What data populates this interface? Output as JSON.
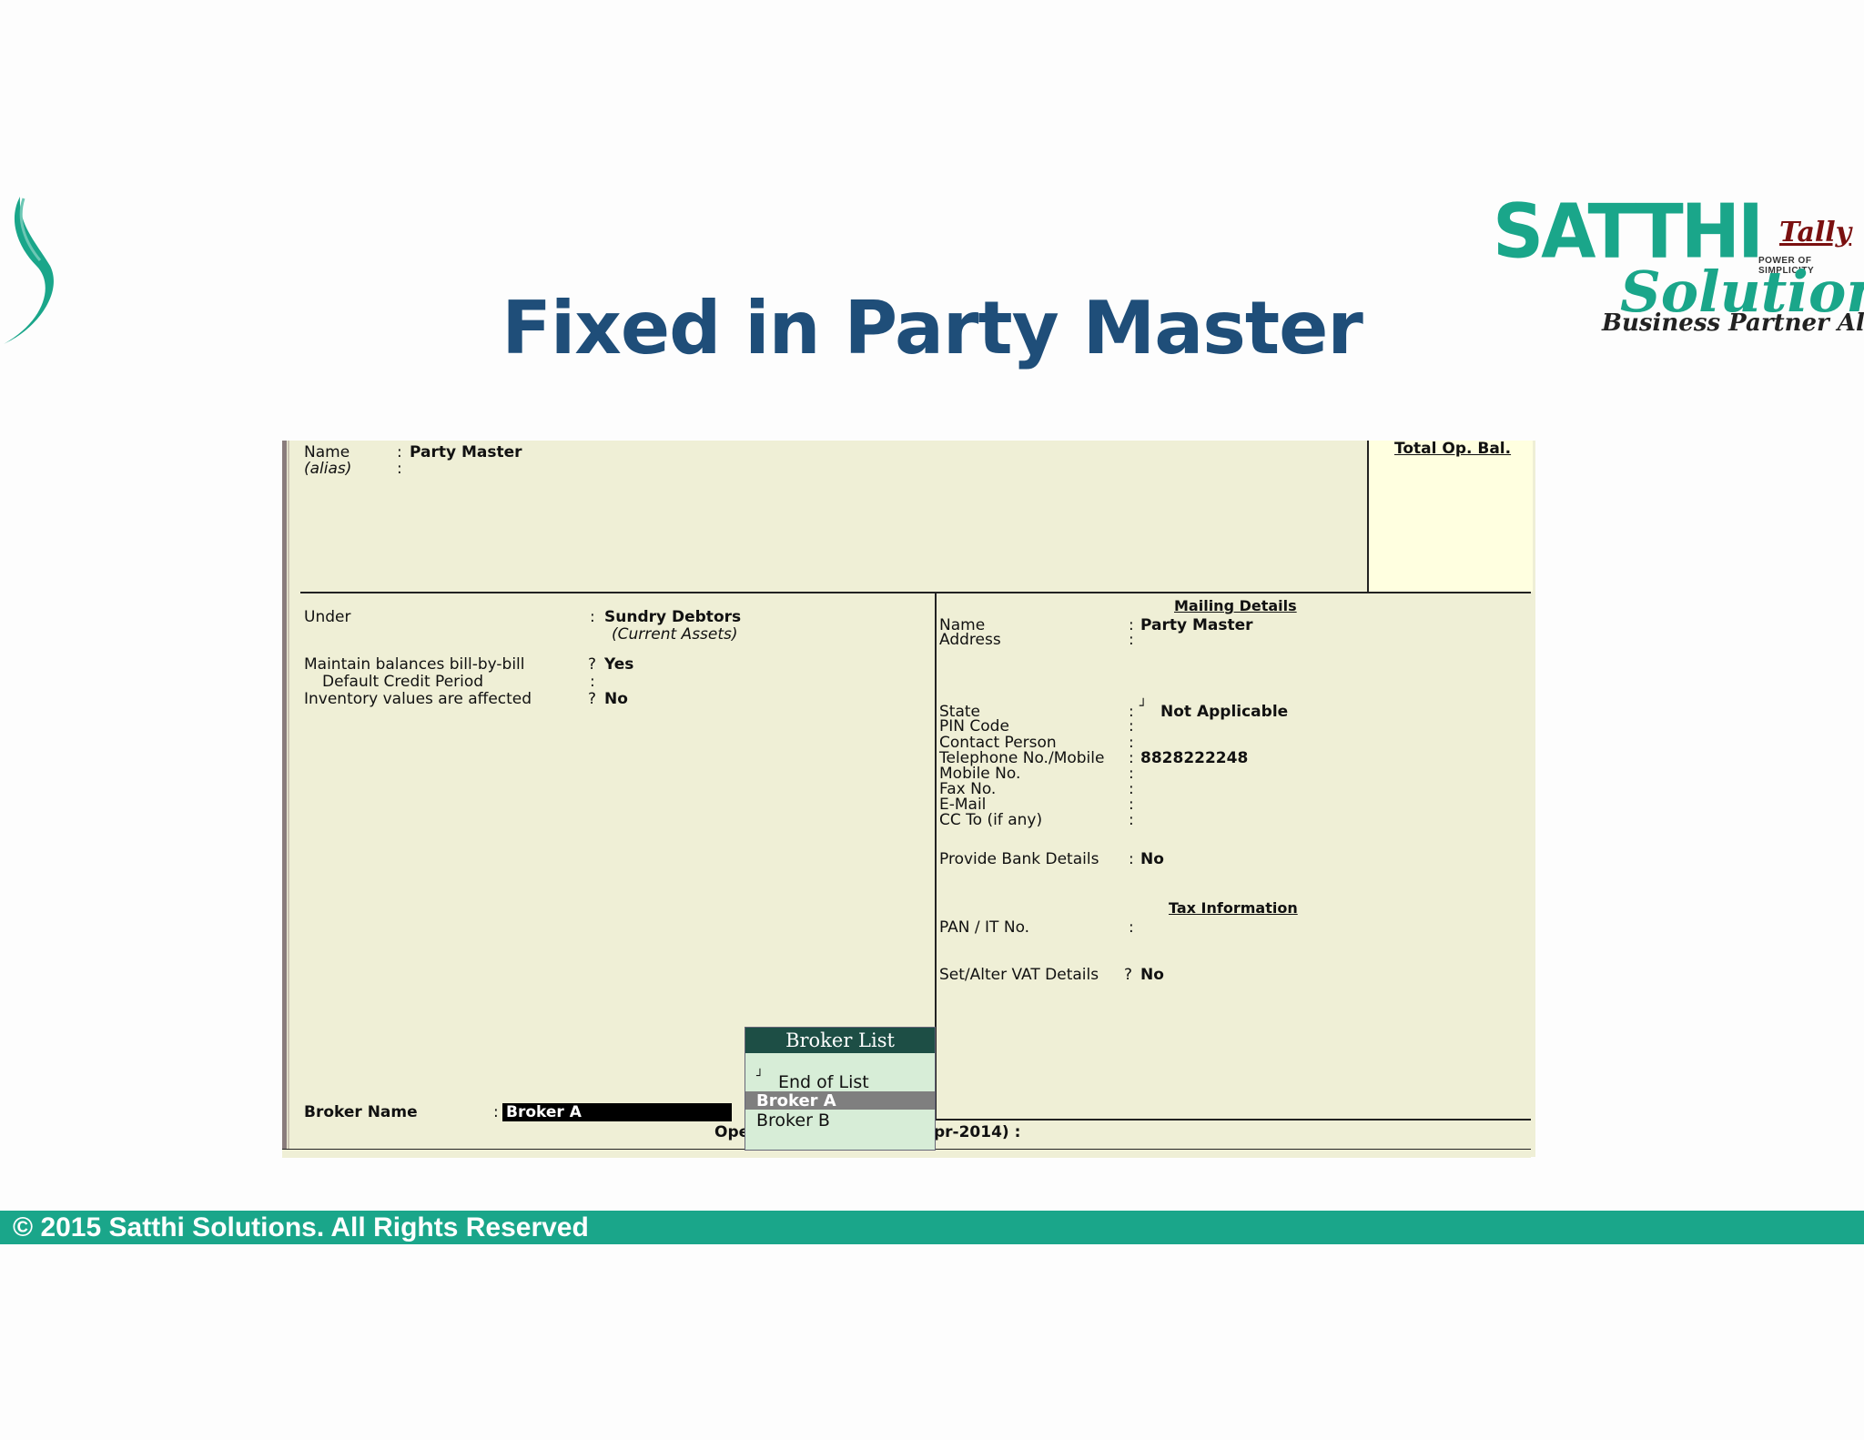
{
  "slide": {
    "title": "Fixed in Party Master",
    "footer": "© 2015 Satthi Solutions. All Rights Reserved"
  },
  "logo": {
    "brand": "SATTHI",
    "brand2": "Solutions",
    "tally": "Tally",
    "power": "POWER OF SIMPLICITY",
    "tagline": "Business Partner Always"
  },
  "colors": {
    "accent": "#1aa68a",
    "title": "#1f4e79",
    "panel_bg": "#efefd6"
  },
  "ledger": {
    "name_label": "Name",
    "name_sep": ":",
    "name_value": "Party Master",
    "alias_label": "(alias)",
    "alias_sep": ":",
    "total_op_bal": "Total Op. Bal.",
    "under_label": "Under",
    "under_sep": ":",
    "under_value": "Sundry Debtors",
    "under_group": "(Current Assets)",
    "bill_label": "Maintain balances bill-by-bill",
    "bill_sep": "?",
    "bill_value": "Yes",
    "credit_label": "Default Credit Period",
    "credit_sep": ":",
    "inv_label": "Inventory values are affected",
    "inv_sep": "?",
    "inv_value": "No",
    "broker_label": "Broker Name",
    "broker_sep": ":",
    "broker_value": "Broker A",
    "opening_left": "Ope",
    "opening_right": "pr-2014)  :"
  },
  "mailing": {
    "heading": "Mailing Details",
    "fields": [
      {
        "label": "Name",
        "sep": ":",
        "value": "Party Master"
      },
      {
        "label": "Address",
        "sep": ":",
        "value": ""
      },
      {
        "label": "State",
        "sep": ":",
        "value": "Not Applicable"
      },
      {
        "label": "PIN Code",
        "sep": ":",
        "value": ""
      },
      {
        "label": "Contact Person",
        "sep": ":",
        "value": ""
      },
      {
        "label": "Telephone No./Mobile",
        "sep": ":",
        "value": "8828222248"
      },
      {
        "label": "Mobile No.",
        "sep": ":",
        "value": ""
      },
      {
        "label": "Fax No.",
        "sep": ":",
        "value": ""
      },
      {
        "label": "E-Mail",
        "sep": ":",
        "value": ""
      },
      {
        "label": "CC To (if any)",
        "sep": ":",
        "value": ""
      },
      {
        "label": "Provide Bank Details",
        "sep": ":",
        "value": "No"
      }
    ],
    "tax_heading": "Tax Information",
    "pan_label": "PAN / IT No.",
    "pan_sep": ":",
    "vat_label": "Set/Alter VAT Details",
    "vat_sep": "?",
    "vat_value": "No"
  },
  "broker_list": {
    "title": "Broker List",
    "items": [
      "End of List",
      "Broker A",
      "Broker B"
    ],
    "selected": "Broker A"
  }
}
